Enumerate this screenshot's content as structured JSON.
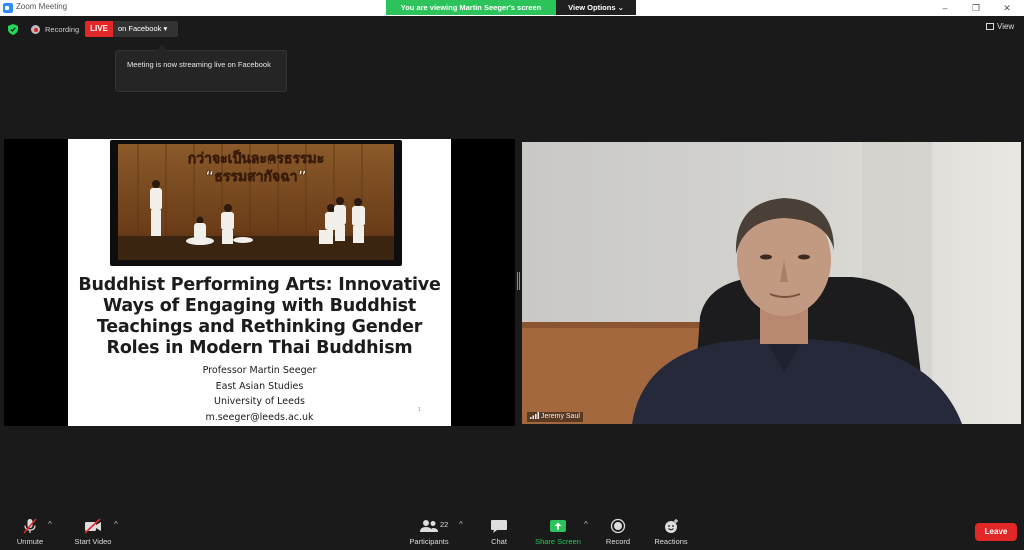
{
  "window": {
    "title": "Zoom Meeting",
    "minimize": "–",
    "maximize": "❐",
    "close": "✕"
  },
  "banner": {
    "viewing_text": "You are viewing Martin Seeger's screen",
    "view_options": "View Options ⌄"
  },
  "status": {
    "recording_label": "Recording",
    "live_label": "LIVE",
    "live_target": "on Facebook ▾",
    "view_label": "View"
  },
  "tooltip": {
    "text": "Meeting is now streaming live on Facebook"
  },
  "slide": {
    "photo_caption_line1": "กว่าจะเป็นละครธรรมะ",
    "photo_caption_line2": "“ธรรมสากัจฉา”",
    "title": "Buddhist Performing Arts: Innovative Ways of Engaging with Buddhist Teachings and Rethinking Gender Roles in Modern Thai Buddhism",
    "presenter": "Professor Martin Seeger",
    "department": "East Asian Studies",
    "university": "University of Leeds",
    "email": "m.seeger@leeds.ac.uk",
    "page_mark": "1"
  },
  "video": {
    "participant_name": "Jeremy Saul"
  },
  "toolbar": {
    "unmute": "Unmute",
    "start_video": "Start Video",
    "participants": "Participants",
    "participants_count": "22",
    "chat": "Chat",
    "share_screen": "Share Screen",
    "record": "Record",
    "reactions": "Reactions",
    "leave": "Leave",
    "caret": "^"
  },
  "colors": {
    "live_red": "#e02828",
    "share_green": "#2bc35a",
    "security_green": "#23d959",
    "background": "#1a1a1a"
  }
}
